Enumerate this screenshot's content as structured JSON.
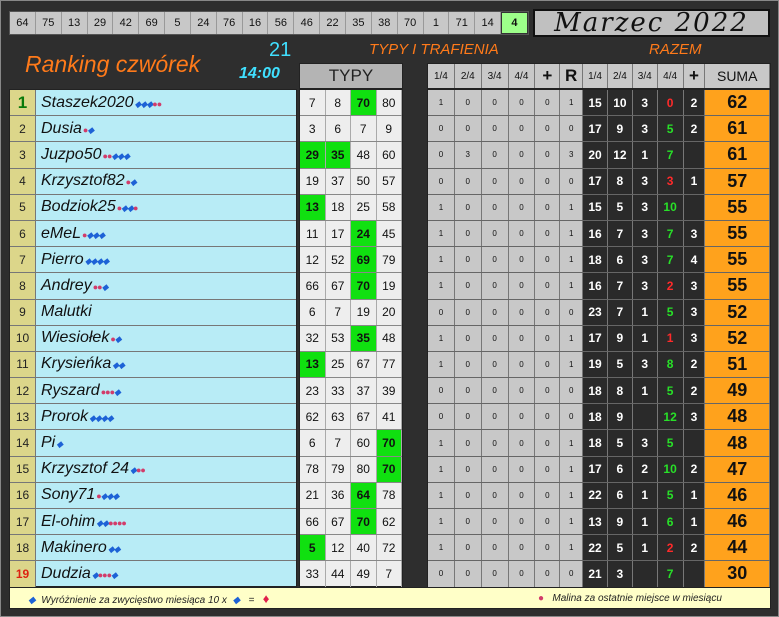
{
  "top_numbers": [
    "64",
    "75",
    "13",
    "29",
    "42",
    "69",
    "5",
    "24",
    "76",
    "16",
    "56",
    "46",
    "22",
    "35",
    "38",
    "70",
    "1",
    "71",
    "14",
    "4"
  ],
  "highlight_index": 19,
  "month": "Marzec 2022",
  "title": "Ranking czwórek",
  "day": "21",
  "time": "14:00",
  "header_typy_trafienia": "TYPY I TRAFIENIA",
  "header_razem": "RAZEM",
  "typy_label": "TYPY",
  "stat_headers": [
    "1/4",
    "2/4",
    "3/4",
    "4/4",
    "+",
    "R",
    "1/4",
    "2/4",
    "3/4",
    "4/4",
    "+",
    "SUMA"
  ],
  "rows": [
    {
      "rank": "1",
      "name": "Staszek2020",
      "badges": "dddmm",
      "typy": [
        "7",
        "8",
        "70",
        "80"
      ],
      "hits": [
        2
      ],
      "s": [
        "1",
        "0",
        "0",
        "0",
        "0",
        "1"
      ],
      "r": [
        "15",
        "10",
        "3",
        "0"
      ],
      "rc": [
        0,
        0,
        0,
        1
      ],
      "plus": "2",
      "suma": "62"
    },
    {
      "rank": "2",
      "name": "Dusia",
      "badges": "md",
      "typy": [
        "3",
        "6",
        "7",
        "9"
      ],
      "hits": [],
      "s": [
        "0",
        "0",
        "0",
        "0",
        "0",
        "0"
      ],
      "r": [
        "17",
        "9",
        "3",
        "5"
      ],
      "rc": [
        0,
        0,
        0,
        2
      ],
      "plus": "2",
      "suma": "61"
    },
    {
      "rank": "3",
      "name": "Juzpo50",
      "badges": "mmddd",
      "typy": [
        "29",
        "35",
        "48",
        "60"
      ],
      "hits": [
        0,
        1
      ],
      "s": [
        "0",
        "3",
        "0",
        "0",
        "0",
        "3"
      ],
      "r": [
        "20",
        "12",
        "1",
        "7"
      ],
      "rc": [
        0,
        0,
        0,
        2
      ],
      "plus": "",
      "suma": "61"
    },
    {
      "rank": "4",
      "name": "Krzysztof82",
      "badges": "md",
      "typy": [
        "19",
        "37",
        "50",
        "57"
      ],
      "hits": [],
      "s": [
        "0",
        "0",
        "0",
        "0",
        "0",
        "0"
      ],
      "r": [
        "17",
        "8",
        "3",
        "3"
      ],
      "rc": [
        0,
        0,
        0,
        1
      ],
      "plus": "1",
      "suma": "57"
    },
    {
      "rank": "5",
      "name": "Bodziok25",
      "badges": "mddm",
      "typy": [
        "13",
        "18",
        "25",
        "58"
      ],
      "hits": [
        0
      ],
      "s": [
        "1",
        "0",
        "0",
        "0",
        "0",
        "1"
      ],
      "r": [
        "15",
        "5",
        "3",
        "10"
      ],
      "rc": [
        0,
        0,
        0,
        2
      ],
      "plus": "",
      "suma": "55"
    },
    {
      "rank": "6",
      "name": "eMeL",
      "badges": "mddd",
      "typy": [
        "11",
        "17",
        "24",
        "45"
      ],
      "hits": [
        2
      ],
      "s": [
        "1",
        "0",
        "0",
        "0",
        "0",
        "1"
      ],
      "r": [
        "16",
        "7",
        "3",
        "7"
      ],
      "rc": [
        0,
        0,
        0,
        2
      ],
      "plus": "3",
      "suma": "55"
    },
    {
      "rank": "7",
      "name": "Pierro",
      "badges": "dddd",
      "typy": [
        "12",
        "52",
        "69",
        "79"
      ],
      "hits": [
        2
      ],
      "s": [
        "1",
        "0",
        "0",
        "0",
        "0",
        "1"
      ],
      "r": [
        "18",
        "6",
        "3",
        "7"
      ],
      "rc": [
        0,
        0,
        0,
        2
      ],
      "plus": "4",
      "suma": "55"
    },
    {
      "rank": "8",
      "name": "Andrey",
      "badges": "mmd",
      "typy": [
        "66",
        "67",
        "70",
        "19"
      ],
      "hits": [
        2
      ],
      "s": [
        "1",
        "0",
        "0",
        "0",
        "0",
        "1"
      ],
      "r": [
        "16",
        "7",
        "3",
        "2"
      ],
      "rc": [
        0,
        0,
        0,
        1
      ],
      "plus": "3",
      "suma": "55"
    },
    {
      "rank": "9",
      "name": "Malutki",
      "badges": "",
      "typy": [
        "6",
        "7",
        "19",
        "20"
      ],
      "hits": [],
      "s": [
        "0",
        "0",
        "0",
        "0",
        "0",
        "0"
      ],
      "r": [
        "23",
        "7",
        "1",
        "5"
      ],
      "rc": [
        0,
        0,
        0,
        2
      ],
      "plus": "3",
      "suma": "52"
    },
    {
      "rank": "10",
      "name": "Wiesiołek",
      "badges": "md",
      "typy": [
        "32",
        "53",
        "35",
        "48"
      ],
      "hits": [
        2
      ],
      "s": [
        "1",
        "0",
        "0",
        "0",
        "0",
        "1"
      ],
      "r": [
        "17",
        "9",
        "1",
        "1"
      ],
      "rc": [
        0,
        0,
        0,
        1
      ],
      "plus": "3",
      "suma": "52"
    },
    {
      "rank": "11",
      "name": "Krysieńka",
      "badges": "dd",
      "typy": [
        "13",
        "25",
        "67",
        "77"
      ],
      "hits": [
        0
      ],
      "s": [
        "1",
        "0",
        "0",
        "0",
        "0",
        "1"
      ],
      "r": [
        "19",
        "5",
        "3",
        "8"
      ],
      "rc": [
        0,
        0,
        0,
        2
      ],
      "plus": "2",
      "suma": "51"
    },
    {
      "rank": "12",
      "name": "Ryszard",
      "badges": "mmmd",
      "typy": [
        "23",
        "33",
        "37",
        "39"
      ],
      "hits": [],
      "s": [
        "0",
        "0",
        "0",
        "0",
        "0",
        "0"
      ],
      "r": [
        "18",
        "8",
        "1",
        "5"
      ],
      "rc": [
        0,
        0,
        0,
        2
      ],
      "plus": "2",
      "suma": "49"
    },
    {
      "rank": "13",
      "name": "Prorok",
      "badges": "dddd",
      "typy": [
        "62",
        "63",
        "67",
        "41"
      ],
      "hits": [],
      "s": [
        "0",
        "0",
        "0",
        "0",
        "0",
        "0"
      ],
      "r": [
        "18",
        "9",
        "",
        "12"
      ],
      "rc": [
        0,
        0,
        0,
        2
      ],
      "plus": "3",
      "suma": "48"
    },
    {
      "rank": "14",
      "name": "Pi",
      "badges": "d",
      "typy": [
        "6",
        "7",
        "60",
        "70"
      ],
      "hits": [
        3
      ],
      "s": [
        "1",
        "0",
        "0",
        "0",
        "0",
        "1"
      ],
      "r": [
        "18",
        "5",
        "3",
        "5"
      ],
      "rc": [
        0,
        0,
        0,
        2
      ],
      "plus": "",
      "suma": "48"
    },
    {
      "rank": "15",
      "name": "Krzysztof 24",
      "badges": "dmm",
      "typy": [
        "78",
        "79",
        "80",
        "70"
      ],
      "hits": [
        3
      ],
      "s": [
        "1",
        "0",
        "0",
        "0",
        "0",
        "1"
      ],
      "r": [
        "17",
        "6",
        "2",
        "10"
      ],
      "rc": [
        0,
        0,
        0,
        2
      ],
      "plus": "2",
      "suma": "47"
    },
    {
      "rank": "16",
      "name": "Sony71",
      "badges": "mddd",
      "typy": [
        "21",
        "36",
        "64",
        "78"
      ],
      "hits": [
        2
      ],
      "s": [
        "1",
        "0",
        "0",
        "0",
        "0",
        "1"
      ],
      "r": [
        "22",
        "6",
        "1",
        "5"
      ],
      "rc": [
        0,
        0,
        0,
        2
      ],
      "plus": "1",
      "suma": "46"
    },
    {
      "rank": "17",
      "name": "El-ohim",
      "badges": "ddmmmm",
      "typy": [
        "66",
        "67",
        "70",
        "62"
      ],
      "hits": [
        2
      ],
      "s": [
        "1",
        "0",
        "0",
        "0",
        "0",
        "1"
      ],
      "r": [
        "13",
        "9",
        "1",
        "6"
      ],
      "rc": [
        0,
        0,
        0,
        2
      ],
      "plus": "1",
      "suma": "46"
    },
    {
      "rank": "18",
      "name": "Makinero",
      "badges": "dd",
      "typy": [
        "5",
        "12",
        "40",
        "72"
      ],
      "hits": [
        0
      ],
      "s": [
        "1",
        "0",
        "0",
        "0",
        "0",
        "1"
      ],
      "r": [
        "22",
        "5",
        "1",
        "2"
      ],
      "rc": [
        0,
        0,
        0,
        1
      ],
      "plus": "2",
      "suma": "44"
    },
    {
      "rank": "19",
      "name": "Dudzia",
      "badges": "dmmmd",
      "typy": [
        "33",
        "44",
        "49",
        "7"
      ],
      "hits": [],
      "s": [
        "0",
        "0",
        "0",
        "0",
        "0",
        "0"
      ],
      "r": [
        "21",
        "3",
        "",
        "7"
      ],
      "rc": [
        0,
        0,
        0,
        2
      ],
      "plus": "",
      "suma": "30"
    }
  ],
  "footer_left": "Wyróżnienie za zwycięstwo miesiąca  10 x",
  "footer_eq": "=",
  "footer_right": "Malina za ostatnie miejsce w miesiącu",
  "colors": {
    "orange": "#ff7a1a",
    "cyan": "#40e0ff",
    "green_hit": "#10e010",
    "suma_bg": "#ffa21c",
    "name_bg": "#b8ecf6"
  }
}
